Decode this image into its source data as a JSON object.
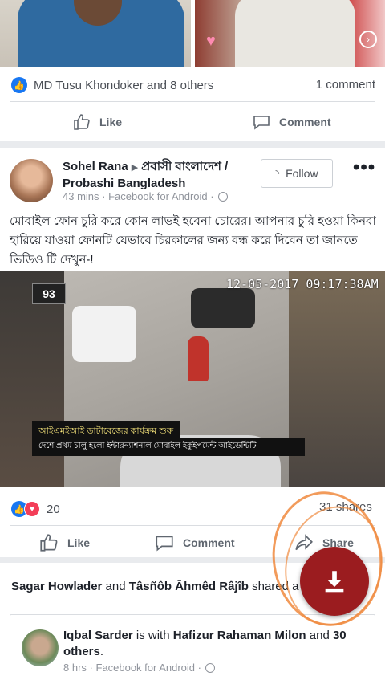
{
  "post1": {
    "reactions_text": "MD Tusu Khondoker and 8 others",
    "comments_text": "1 comment",
    "like_label": "Like",
    "comment_label": "Comment"
  },
  "post2": {
    "author": "Sohel Rana",
    "page": "প্রবাসী বাংলাদেশ / Probashi Bangladesh",
    "meta": "43 mins · Facebook for Android ·",
    "follow_label": "Follow",
    "more_label": "•••",
    "text": "মোবাইল ফোন চুরি করে কোন লাভই হবেনা চোরের। আপনার চুরি হওয়া কিনবা হারিয়ে যাওয়া ফোনটি যেভাবে চিরকালের জন্য বন্ধ করে দিবেন তা জানতে ভিডিও টি দেখুন-!",
    "video": {
      "timestamp": "12-05-2017 09:17:38AM",
      "logo": "93",
      "ticker_line1": "আইএমইআই ডাটাবেজের কার্যক্রম শুরু",
      "ticker_line2": "দেশে প্রথম চালু হলো ইন্টারন্যাশনাল মোবাইল ইকুইপমেন্ট আইডেন্টিটি"
    },
    "reaction_count": "20",
    "shares_text": "31 shares",
    "like_label": "Like",
    "comment_label": "Comment",
    "share_label": "Share"
  },
  "shared": {
    "user1": "Sagar Howlader",
    "and": "and",
    "user2": "Tâsñôb Āhmêd Râjîb",
    "suffix": "shared a"
  },
  "embedded_post": {
    "author": "Iqbal Sarder",
    "with": "is with",
    "tagged": "Hafizur Rahaman Milon",
    "and": "and",
    "others": "30 others",
    "meta": "8 hrs · Facebook for Android ·"
  },
  "colors": {
    "facebook_blue": "#1877f2",
    "love_red": "#f33e58",
    "download_button": "#9b1c1f",
    "annotation_orange": "#f08a3e"
  },
  "icons": [
    "like-icon",
    "love-icon",
    "thumbs-up-icon",
    "comment-icon",
    "share-icon",
    "rss-icon",
    "globe-icon",
    "download-icon"
  ]
}
